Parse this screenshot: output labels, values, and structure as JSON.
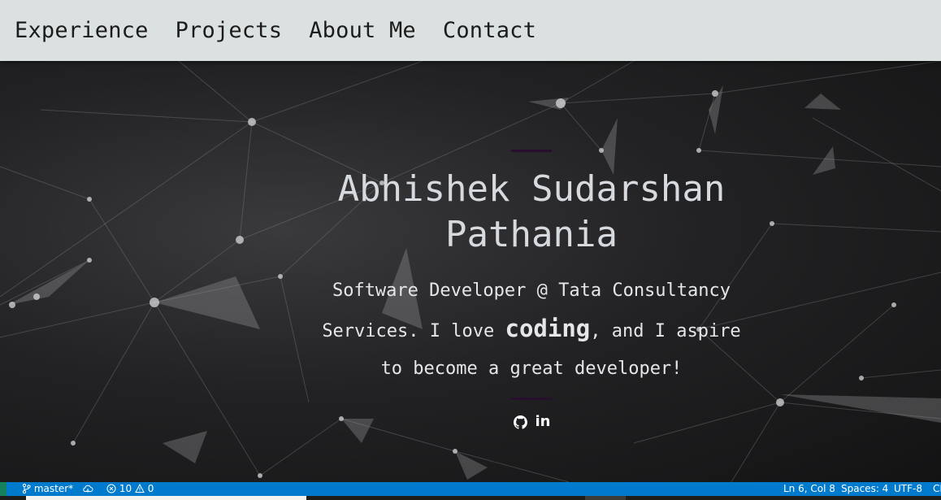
{
  "nav": {
    "items": [
      {
        "label": "Experience"
      },
      {
        "label": "Projects"
      },
      {
        "label": "About Me"
      },
      {
        "label": "Contact"
      }
    ]
  },
  "hero": {
    "name_line1": "Abhishek Sudarshan",
    "name_line2": "Pathania",
    "tagline_part1": "Software Developer @ Tata Consultancy Services. I love ",
    "tagline_emphasis": "coding",
    "tagline_part2": ", and I aspire to become a great developer!",
    "social": {
      "github_icon": "github-icon",
      "linkedin_label": "in"
    }
  },
  "statusbar": {
    "branch": "master*",
    "errors": "10",
    "warnings": "0",
    "position": "Ln 6, Col 8",
    "spaces": "Spaces: 4",
    "encoding": "UTF-8",
    "eol_truncated": "CI"
  },
  "colors": {
    "navbar_bg": "#dbe0e1",
    "statusbar_bg": "#007acc",
    "divider": "#2a0e30",
    "hero_text": "#d6d9de"
  }
}
